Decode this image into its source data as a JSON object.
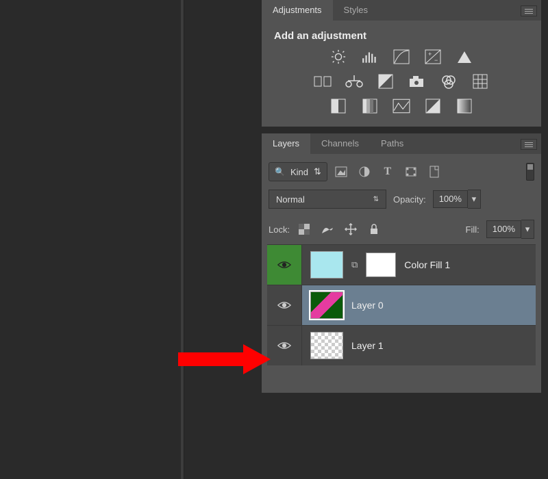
{
  "adjustments_panel": {
    "tabs": {
      "adjustments": "Adjustments",
      "styles": "Styles"
    },
    "title": "Add an adjustment"
  },
  "layers_panel": {
    "tabs": {
      "layers": "Layers",
      "channels": "Channels",
      "paths": "Paths"
    },
    "kind_label": "Kind",
    "blend_mode": "Normal",
    "opacity_label": "Opacity:",
    "opacity_value": "100%",
    "lock_label": "Lock:",
    "fill_label": "Fill:",
    "fill_value": "100%",
    "layers": [
      {
        "name": "Color Fill 1"
      },
      {
        "name": "Layer 0"
      },
      {
        "name": "Layer 1"
      }
    ]
  }
}
